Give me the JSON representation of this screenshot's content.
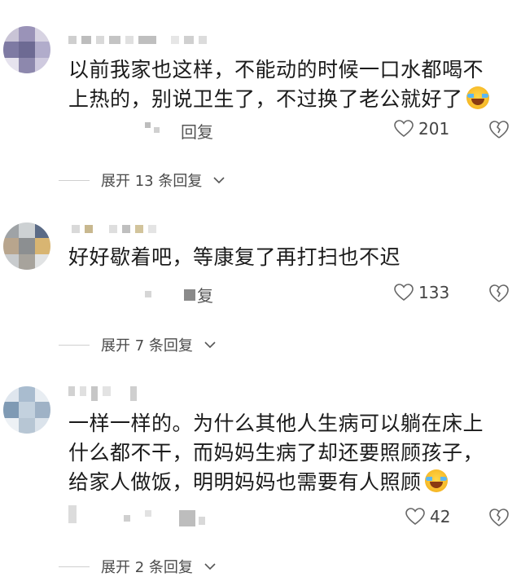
{
  "comments": [
    {
      "text": "以前我家也这样，不能动的时候一口水都喝不上热的，别说卫生了，不过换了老公就好了",
      "emoji": "laughing-crying-emoji",
      "reply_label": "回复",
      "likes": "201",
      "expand_label": "展开 13 条回复"
    },
    {
      "text": "好好歇着吧，等康复了再打扫也不迟",
      "reply_label": "复",
      "likes": "133",
      "expand_label": "展开 7 条回复"
    },
    {
      "text": "一样一样的。为什么其他人生病可以躺在床上什么都不干，而妈妈生病了却还要照顾孩子，给家人做饭，明明妈妈也需要有人照顾",
      "emoji": "laughing-crying-emoji",
      "likes": "42",
      "expand_label": "展开 2 条回复"
    }
  ],
  "colors": {
    "text": "#1b1b1b",
    "meta": "#555555",
    "divider": "#cfcfcf"
  },
  "icons": [
    "heart-outline-icon",
    "broken-heart-icon",
    "chevron-down-icon"
  ]
}
